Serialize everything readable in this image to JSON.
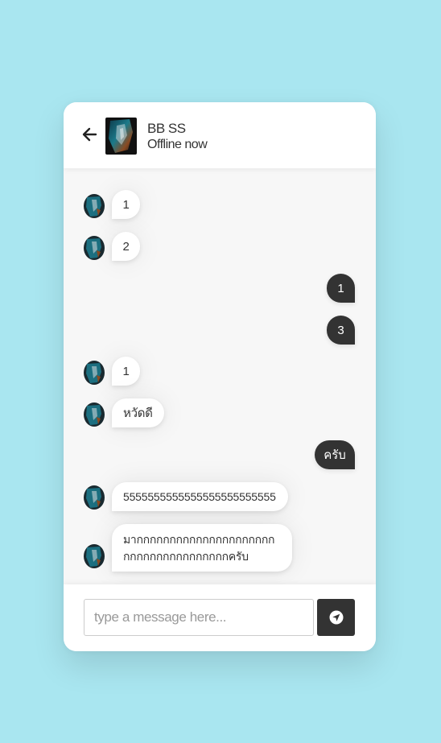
{
  "header": {
    "name": "BB SS",
    "status": "Offline now",
    "back_icon": "arrow-left-icon",
    "avatar": "contact-avatar"
  },
  "messages": [
    {
      "direction": "incoming",
      "text": "1"
    },
    {
      "direction": "incoming",
      "text": "2"
    },
    {
      "direction": "outgoing",
      "text": "1"
    },
    {
      "direction": "outgoing",
      "text": "3"
    },
    {
      "direction": "incoming",
      "text": "1"
    },
    {
      "direction": "incoming",
      "text": "หวัดดี"
    },
    {
      "direction": "outgoing",
      "text": "ครับ"
    },
    {
      "direction": "incoming",
      "text": "5555555555555555555555555"
    },
    {
      "direction": "incoming",
      "text": "มากกกกกกกกกกกกกกกกกกกกกกกกกกกกกกกกกกกกกครับ"
    }
  ],
  "composer": {
    "placeholder": "type a message here...",
    "value": "",
    "send_icon": "send-icon"
  },
  "colors": {
    "page_background": "#a9e6f0",
    "outgoing_bubble": "#333333",
    "incoming_bubble": "#ffffff",
    "chat_background": "#f7f7f7"
  }
}
